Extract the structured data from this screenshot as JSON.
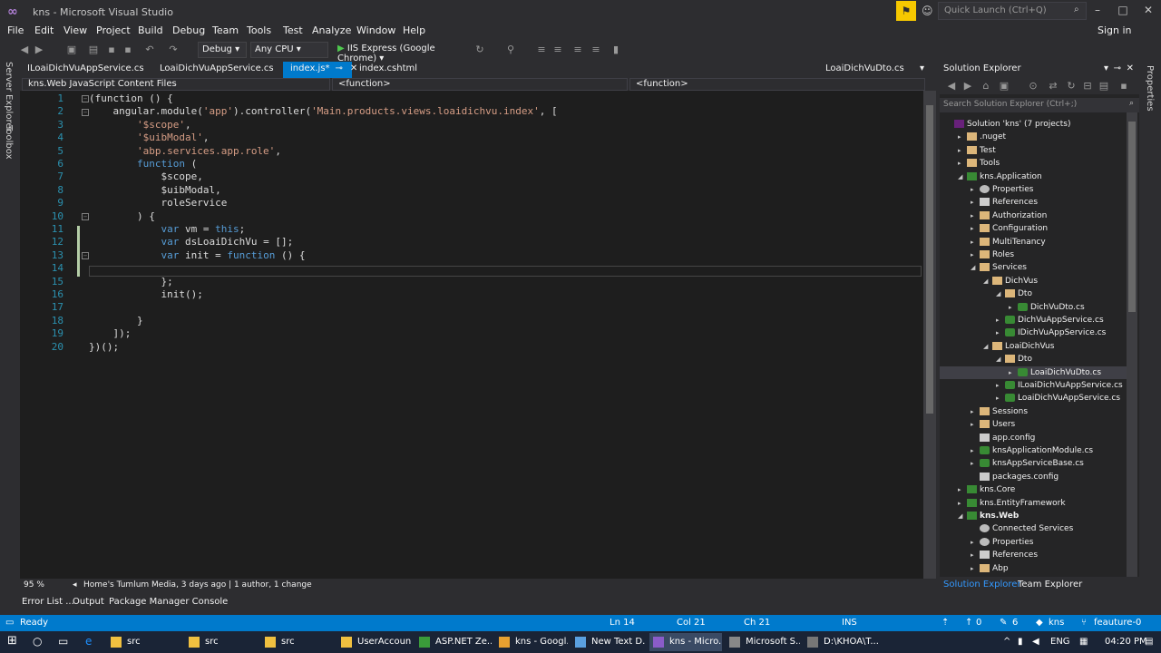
{
  "window": {
    "title": "kns - Microsoft Visual Studio",
    "quick_launch_placeholder": "Quick Launch (Ctrl+Q)",
    "sign_in": "Sign in"
  },
  "menu": [
    "File",
    "Edit",
    "View",
    "Project",
    "Build",
    "Debug",
    "Team",
    "Tools",
    "Test",
    "Analyze",
    "Window",
    "Help"
  ],
  "toolbar": {
    "config": "Debug",
    "platform": "Any CPU",
    "run_target": "IIS Express (Google Chrome)"
  },
  "side_left": [
    "Server Explorer",
    "Toolbox"
  ],
  "side_right": "Properties",
  "tabs": [
    {
      "label": "ILoaiDichVuAppService.cs"
    },
    {
      "label": "LoaiDichVuAppService.cs"
    },
    {
      "label": "index.js*",
      "active": true
    },
    {
      "label": "index.cshtml"
    },
    {
      "label": "LoaiDichVuDto.cs"
    }
  ],
  "nav": {
    "project": "kns.Web JavaScript Content Files",
    "scope": "<function>",
    "member": "<function>"
  },
  "code": {
    "line_numbers": [
      "1",
      "2",
      "3",
      "4",
      "5",
      "6",
      "7",
      "8",
      "9",
      "10",
      "11",
      "12",
      "13",
      "14",
      "15",
      "16",
      "17",
      "18",
      "19",
      "20"
    ],
    "lines": [
      [
        "",
        [
          [
            "p",
            "(function () {"
          ]
        ]
      ],
      [
        "    ",
        [
          [
            "p",
            "angular.module("
          ],
          [
            "s",
            "'app'"
          ],
          [
            "p",
            ").controller("
          ],
          [
            "s",
            "'Main.products.views.loaidichvu.index'"
          ],
          [
            "p",
            ", ["
          ]
        ]
      ],
      [
        "        ",
        [
          [
            "s",
            "'$scope'"
          ],
          [
            "p",
            ","
          ]
        ]
      ],
      [
        "        ",
        [
          [
            "s",
            "'$uibModal'"
          ],
          [
            "p",
            ","
          ]
        ]
      ],
      [
        "        ",
        [
          [
            "s",
            "'abp.services.app.role'"
          ],
          [
            "p",
            ","
          ]
        ]
      ],
      [
        "        ",
        [
          [
            "k",
            "function"
          ],
          [
            "p",
            " ("
          ]
        ]
      ],
      [
        "            ",
        [
          [
            "p",
            "$scope,"
          ]
        ]
      ],
      [
        "            ",
        [
          [
            "p",
            "$uibModal,"
          ]
        ]
      ],
      [
        "            ",
        [
          [
            "p",
            "roleService"
          ]
        ]
      ],
      [
        "        ",
        [
          [
            "p",
            ") {"
          ]
        ]
      ],
      [
        "            ",
        [
          [
            "k",
            "var"
          ],
          [
            "p",
            " vm = "
          ],
          [
            "k",
            "this"
          ],
          [
            "p",
            ";"
          ]
        ]
      ],
      [
        "            ",
        [
          [
            "k",
            "var"
          ],
          [
            "p",
            " dsLoaiDichVu = [];"
          ]
        ]
      ],
      [
        "            ",
        [
          [
            "k",
            "var"
          ],
          [
            "p",
            " init = "
          ],
          [
            "k",
            "function"
          ],
          [
            "p",
            " () {"
          ]
        ]
      ],
      [
        "",
        []
      ],
      [
        "            ",
        [
          [
            "p",
            "};"
          ]
        ]
      ],
      [
        "            ",
        [
          [
            "p",
            "init();"
          ]
        ]
      ],
      [
        "",
        []
      ],
      [
        "        ",
        [
          [
            "p",
            "}"
          ]
        ]
      ],
      [
        "    ",
        [
          [
            "p",
            "]);"
          ]
        ]
      ],
      [
        "",
        [
          [
            "p",
            "})();"
          ]
        ]
      ]
    ]
  },
  "editor_status": {
    "zoom": "95 %",
    "codelens": "Home's Tumlum Media, 3 days ago | 1 author, 1 change"
  },
  "solution_explorer": {
    "title": "Solution Explorer",
    "search_placeholder": "Search Solution Explorer (Ctrl+;)",
    "items": [
      {
        "label": "Solution 'kns' (7 projects)",
        "depth": 0,
        "icon": "sol",
        "tw": ""
      },
      {
        "label": ".nuget",
        "depth": 1,
        "icon": "folder",
        "tw": "▸"
      },
      {
        "label": "Test",
        "depth": 1,
        "icon": "folder",
        "tw": "▸"
      },
      {
        "label": "Tools",
        "depth": 1,
        "icon": "folder",
        "tw": "▸"
      },
      {
        "label": "kns.Application",
        "depth": 1,
        "icon": "proj",
        "tw": "◢"
      },
      {
        "label": "Properties",
        "depth": 2,
        "icon": "gear",
        "tw": "▸"
      },
      {
        "label": "References",
        "depth": 2,
        "icon": "ref",
        "tw": "▸"
      },
      {
        "label": "Authorization",
        "depth": 2,
        "icon": "folder",
        "tw": "▸"
      },
      {
        "label": "Configuration",
        "depth": 2,
        "icon": "folder",
        "tw": "▸"
      },
      {
        "label": "MultiTenancy",
        "depth": 2,
        "icon": "folder",
        "tw": "▸"
      },
      {
        "label": "Roles",
        "depth": 2,
        "icon": "folder",
        "tw": "▸"
      },
      {
        "label": "Services",
        "depth": 2,
        "icon": "folder",
        "tw": "◢"
      },
      {
        "label": "DichVus",
        "depth": 3,
        "icon": "folder",
        "tw": "◢"
      },
      {
        "label": "Dto",
        "depth": 4,
        "icon": "folder",
        "tw": "◢"
      },
      {
        "label": "DichVuDto.cs",
        "depth": 5,
        "icon": "cs",
        "tw": "▸"
      },
      {
        "label": "DichVuAppService.cs",
        "depth": 4,
        "icon": "cs",
        "tw": "▸"
      },
      {
        "label": "IDichVuAppService.cs",
        "depth": 4,
        "icon": "cs",
        "tw": "▸"
      },
      {
        "label": "LoaiDichVus",
        "depth": 3,
        "icon": "folder",
        "tw": "◢"
      },
      {
        "label": "Dto",
        "depth": 4,
        "icon": "folder",
        "tw": "◢"
      },
      {
        "label": "LoaiDichVuDto.cs",
        "depth": 5,
        "icon": "cs",
        "tw": "▸",
        "selected": true
      },
      {
        "label": "ILoaiDichVuAppService.cs",
        "depth": 4,
        "icon": "cs",
        "tw": "▸"
      },
      {
        "label": "LoaiDichVuAppService.cs",
        "depth": 4,
        "icon": "cs",
        "tw": "▸"
      },
      {
        "label": "Sessions",
        "depth": 2,
        "icon": "folder",
        "tw": "▸"
      },
      {
        "label": "Users",
        "depth": 2,
        "icon": "folder",
        "tw": "▸"
      },
      {
        "label": "app.config",
        "depth": 2,
        "icon": "ref",
        "tw": ""
      },
      {
        "label": "knsApplicationModule.cs",
        "depth": 2,
        "icon": "cs",
        "tw": "▸"
      },
      {
        "label": "knsAppServiceBase.cs",
        "depth": 2,
        "icon": "cs",
        "tw": "▸"
      },
      {
        "label": "packages.config",
        "depth": 2,
        "icon": "ref",
        "tw": ""
      },
      {
        "label": "kns.Core",
        "depth": 1,
        "icon": "proj",
        "tw": "▸"
      },
      {
        "label": "kns.EntityFramework",
        "depth": 1,
        "icon": "proj",
        "tw": "▸"
      },
      {
        "label": "kns.Web",
        "depth": 1,
        "icon": "proj",
        "tw": "◢"
      },
      {
        "label": "Connected Services",
        "depth": 2,
        "icon": "gear",
        "tw": ""
      },
      {
        "label": "Properties",
        "depth": 2,
        "icon": "gear",
        "tw": "▸"
      },
      {
        "label": "References",
        "depth": 2,
        "icon": "ref",
        "tw": "▸"
      },
      {
        "label": "Abp",
        "depth": 2,
        "icon": "folder",
        "tw": "▸"
      }
    ],
    "tabs": [
      "Solution Explorer",
      "Team Explorer"
    ]
  },
  "bottom_tabs": [
    "Error List ...",
    "Output",
    "Package Manager Console"
  ],
  "status": {
    "ready": "Ready",
    "ln": "Ln 14",
    "col": "Col 21",
    "ch": "Ch 21",
    "ins": "INS",
    "arrows": "0",
    "pencils": "6",
    "repo": "kns",
    "branch": "feauture-0"
  },
  "taskbar": {
    "items": [
      "src",
      "src",
      "src",
      "UserAccoun...",
      "ASP.NET Ze...",
      "kns - Googl...",
      "New Text D...",
      "kns - Micro...",
      "Microsoft S...",
      "D:\\KHOA\\T..."
    ],
    "lang": "ENG",
    "time": "04:20 PM"
  },
  "colors": {
    "accent": "#007acc",
    "keyword": "#569cd6",
    "string": "#d69d85",
    "plain": "#dcdcdc",
    "linenum": "#2b91af"
  }
}
